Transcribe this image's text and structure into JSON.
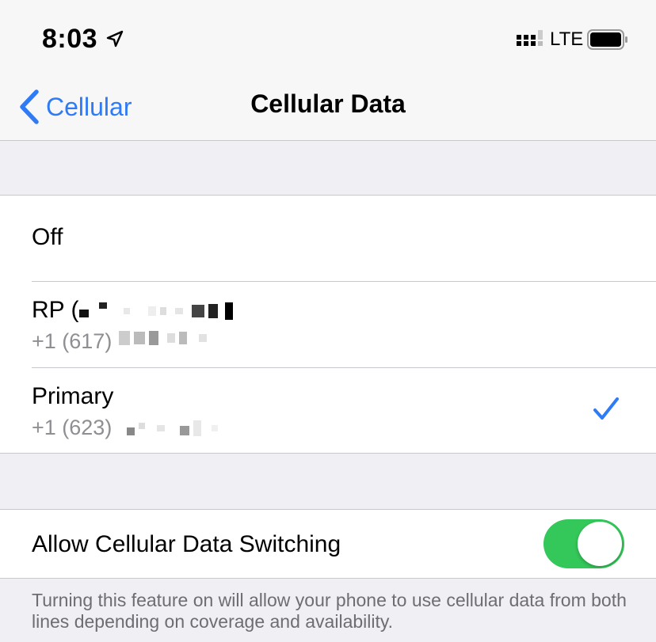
{
  "status_bar": {
    "time": "8:03",
    "network": "LTE",
    "icons": [
      "location-arrow-icon",
      "signal-strength-icon",
      "battery-icon"
    ]
  },
  "nav": {
    "back_label": "Cellular",
    "title": "Cellular Data"
  },
  "lines": {
    "off_label": "Off",
    "rp": {
      "name": "RP (",
      "number": "+1 (617)"
    },
    "primary": {
      "name": "Primary",
      "number": "+1 (623)",
      "selected": true
    }
  },
  "switching": {
    "label": "Allow Cellular Data Switching",
    "enabled": true,
    "footer": "Turning this feature on will allow your phone to use cellular data from both lines depending on coverage and availability."
  },
  "colors": {
    "accent": "#2f7bf6",
    "toggle_on": "#34c759",
    "background": "#efeff4",
    "secondary_text": "#8e8e93"
  }
}
